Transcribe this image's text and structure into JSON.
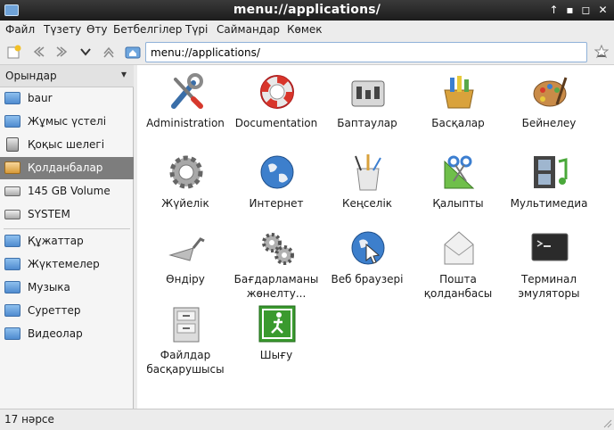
{
  "window": {
    "title": "menu://applications/"
  },
  "menubar": [
    "Файл",
    "Түзету",
    "Өту",
    "Бетбелгілер",
    "Түрі",
    "Саймандар",
    "Көмек"
  ],
  "address": {
    "value": "menu://applications/"
  },
  "sidebar": {
    "header": "Орындар",
    "places": [
      {
        "label": "baur",
        "icon": "home-folder-icon"
      },
      {
        "label": "Жұмыс үстелі",
        "icon": "desktop-icon"
      },
      {
        "label": "Қоқыс шелегі",
        "icon": "trash-icon"
      },
      {
        "label": "Қолданбалар",
        "icon": "applications-icon"
      },
      {
        "label": "145 GB Volume",
        "icon": "drive-icon"
      },
      {
        "label": "SYSTEM",
        "icon": "drive-icon"
      }
    ],
    "bookmarks": [
      {
        "label": "Құжаттар",
        "icon": "folder-icon"
      },
      {
        "label": "Жүктемелер",
        "icon": "folder-icon"
      },
      {
        "label": "Музыка",
        "icon": "folder-icon"
      },
      {
        "label": "Суреттер",
        "icon": "folder-icon"
      },
      {
        "label": "Видеолар",
        "icon": "folder-icon"
      }
    ]
  },
  "items": [
    {
      "label": "Administration",
      "icon": "tools-icon"
    },
    {
      "label": "Documentation",
      "icon": "lifebuoy-icon"
    },
    {
      "label": "Баптаулар",
      "icon": "settings-panel-icon"
    },
    {
      "label": "Басқалар",
      "icon": "other-apps-icon"
    },
    {
      "label": "Бейнелеу",
      "icon": "palette-icon"
    },
    {
      "label": "Жүйелік",
      "icon": "gear-icon"
    },
    {
      "label": "Интернет",
      "icon": "globe-icon"
    },
    {
      "label": "Кеңселік",
      "icon": "pencil-cup-icon"
    },
    {
      "label": "Қалыпты",
      "icon": "scissors-ruler-icon"
    },
    {
      "label": "Мультимедиа",
      "icon": "film-music-icon"
    },
    {
      "label": "Өндіру",
      "icon": "trowel-icon"
    },
    {
      "label": "Бағдарламаны жөнелту...",
      "icon": "gears-icon"
    },
    {
      "label": "Веб браузері",
      "icon": "web-browser-icon"
    },
    {
      "label": "Пошта қолданбасы",
      "icon": "mail-icon"
    },
    {
      "label": "Терминал эмуляторы",
      "icon": "terminal-icon"
    },
    {
      "label": "Файлдар басқарушысы",
      "icon": "file-cabinet-icon"
    },
    {
      "label": "Шығу",
      "icon": "exit-icon"
    }
  ],
  "status": {
    "text": "17 нәрсе"
  }
}
